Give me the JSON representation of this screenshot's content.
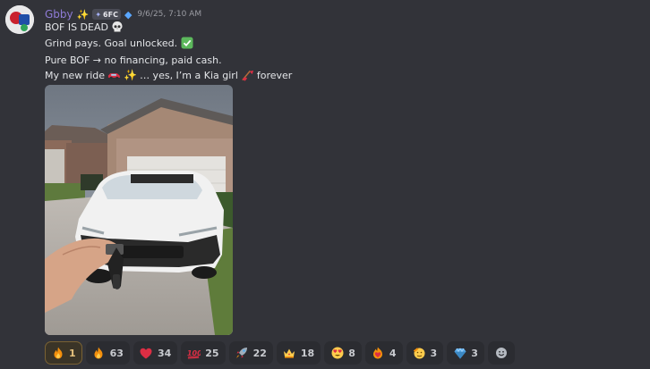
{
  "message": {
    "author": "Gbby",
    "tag": "6FC",
    "timestamp": "9/6/25, 7:10 AM",
    "lines": {
      "l1": "BOF IS DEAD",
      "l2": "Grind pays. Goal unlocked.",
      "l3": "Pure BOF → no financing, paid cash.",
      "l4a": "My new ride",
      "l4b": "… yes, I’m a Kia girl",
      "l4c": "forever"
    }
  },
  "reactions": [
    {
      "icon": "fire-icon",
      "count": "1",
      "active": true
    },
    {
      "icon": "fire-icon",
      "count": "63"
    },
    {
      "icon": "heart-icon",
      "count": "34"
    },
    {
      "icon": "hundred-icon",
      "count": "25"
    },
    {
      "icon": "rocket-icon",
      "count": "22"
    },
    {
      "icon": "crown-icon",
      "count": "18"
    },
    {
      "icon": "heart-eyes-icon",
      "count": "8"
    },
    {
      "icon": "heart-on-fire-icon",
      "count": "4"
    },
    {
      "icon": "saluting-face-icon",
      "count": "3"
    },
    {
      "icon": "gem-icon",
      "count": "3"
    }
  ],
  "colors": {
    "background": "#323339",
    "username": "#8e7bd6",
    "active_reaction_border": "#7a6233"
  }
}
